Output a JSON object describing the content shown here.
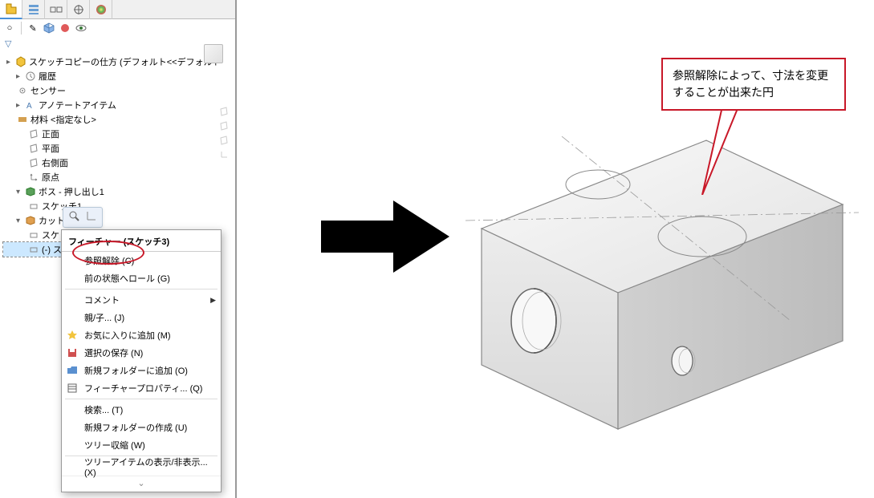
{
  "toolbar": {
    "tabs": [
      "feature-manager",
      "property-manager",
      "configuration-manager",
      "dimxpert",
      "display-manager"
    ]
  },
  "tree": {
    "root_title": "スケッチコピーの仕方 (デフォルト<<デフォルト",
    "items": [
      {
        "icon": "history",
        "label": "履歴",
        "indent": 1,
        "expand": true
      },
      {
        "icon": "sensor",
        "label": "センサー",
        "indent": 1
      },
      {
        "icon": "annotation",
        "label": "アノテートアイテム",
        "indent": 1,
        "expand": true
      },
      {
        "icon": "material",
        "label": "材料 <指定なし>",
        "indent": 1
      },
      {
        "icon": "plane",
        "label": "正面",
        "indent": 2
      },
      {
        "icon": "plane",
        "label": "平面",
        "indent": 2
      },
      {
        "icon": "plane",
        "label": "右側面",
        "indent": 2
      },
      {
        "icon": "origin",
        "label": "原点",
        "indent": 2
      },
      {
        "icon": "boss",
        "label": "ボス - 押し出し1",
        "indent": 1,
        "expand": true
      },
      {
        "icon": "sketch",
        "label": "スケッチ1",
        "indent": 2
      },
      {
        "icon": "cut",
        "label": "カット - 押",
        "indent": 1,
        "expand": true
      },
      {
        "icon": "sketch",
        "label": "スケ",
        "indent": 2
      },
      {
        "icon": "sketch",
        "label": "(-) スケ",
        "indent": 2,
        "selected": true
      }
    ]
  },
  "context_menu": {
    "header": "フィーチャー (スケッチ3)",
    "items": [
      {
        "label": "参照解除 (C)",
        "icon": ""
      },
      {
        "label": "前の状態へロール (G)",
        "icon": ""
      },
      {
        "sep": true
      },
      {
        "label": "コメント",
        "arrow": true
      },
      {
        "label": "親/子... (J)",
        "icon": ""
      },
      {
        "label": "お気に入りに追加 (M)",
        "icon": "star"
      },
      {
        "label": "選択の保存 (N)",
        "icon": "disk"
      },
      {
        "label": "新規フォルダーに追加 (O)",
        "icon": "folder"
      },
      {
        "label": "フィーチャープロパティ... (Q)",
        "icon": "props"
      },
      {
        "sep": true
      },
      {
        "label": "検索... (T)",
        "icon": ""
      },
      {
        "label": "新規フォルダーの作成 (U)",
        "icon": ""
      },
      {
        "label": "ツリー収縮 (W)",
        "icon": ""
      },
      {
        "sep": true
      },
      {
        "label": "ツリーアイテムの表示/非表示... (X)",
        "icon": ""
      }
    ]
  },
  "callout": {
    "text": "参照解除によって、寸法を変更することが出来た円"
  }
}
